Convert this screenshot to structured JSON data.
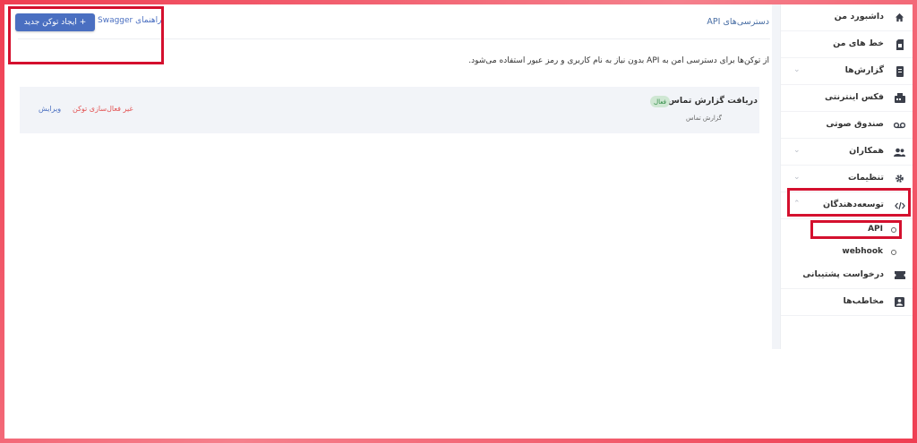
{
  "sidebar": {
    "items": [
      {
        "label": "داشبورد من",
        "icon": "home-icon"
      },
      {
        "label": "خط های من",
        "icon": "sim-card-icon"
      },
      {
        "label": "گزارش‌ها",
        "icon": "report-icon",
        "chevron": "⌄"
      },
      {
        "label": "فکس اینترنتی",
        "icon": "fax-icon"
      },
      {
        "label": "صندوق صوتی",
        "icon": "voicemail-icon"
      },
      {
        "label": "همکاران",
        "icon": "people-icon",
        "chevron": "⌄"
      },
      {
        "label": "تنظیمات",
        "icon": "gear-icon",
        "chevron": "⌄"
      },
      {
        "label": "توسعه‌دهندگان",
        "icon": "code-icon",
        "chevron": "⌃"
      },
      {
        "label": "درخواست پشتیبانی",
        "icon": "ticket-icon"
      },
      {
        "label": "مخاطب‌ها",
        "icon": "contact-icon"
      }
    ],
    "sub_items": [
      {
        "label": "API"
      },
      {
        "label": "webhook"
      }
    ]
  },
  "main": {
    "title": "دسترسی‌های API",
    "description": "از توکن‌ها برای دسترسی امن به API بدون نیاز به نام کاربری و رمز عبور استفاده می‌شود.",
    "create_button": "+ ایجاد توکن جدید",
    "swagger_link": "راهنمای Swagger"
  },
  "token": {
    "title": "دریافت گزارش تماس",
    "status": "فعال",
    "subtitle": "گزارش تماس",
    "disable_label": "غیر فعال‌سازی توکن",
    "edit_label": "ویرایش"
  },
  "colors": {
    "accent": "#4a6fc1",
    "danger": "#e35353",
    "highlight": "#d4102e",
    "badge_bg": "#cfe7d3",
    "badge_text": "#2e8a44"
  }
}
